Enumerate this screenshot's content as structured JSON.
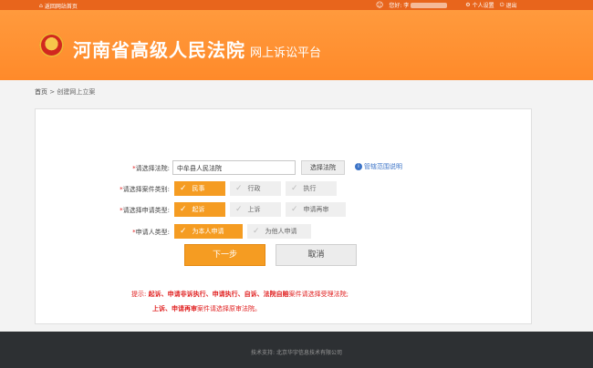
{
  "topbar": {
    "home_link": "返回网站首页",
    "greeting": "您好: 李",
    "personal_settings": "个人设置",
    "logout": "退出"
  },
  "banner": {
    "court_name": "河南省高级人民法院",
    "platform_name": "网上诉讼平台"
  },
  "breadcrumb": {
    "home": "首页",
    "separator": ">",
    "current": "创建网上立案"
  },
  "form": {
    "court": {
      "label": "请选择法院:",
      "value": "中牟县人民法院",
      "select_button": "选择法院",
      "jurisdiction_link": "管辖范围说明"
    },
    "case_type": {
      "label": "请选择案件类别:",
      "options": [
        {
          "label": "民事",
          "selected": true
        },
        {
          "label": "行政",
          "selected": false
        },
        {
          "label": "执行",
          "selected": false
        }
      ]
    },
    "application_type": {
      "label": "请选择申请类型:",
      "options": [
        {
          "label": "起诉",
          "selected": true
        },
        {
          "label": "上诉",
          "selected": false
        },
        {
          "label": "申请再审",
          "selected": false
        }
      ]
    },
    "applicant_type": {
      "label": "申请人类型:",
      "options": [
        {
          "label": "为本人申请",
          "selected": true
        },
        {
          "label": "为他人申请",
          "selected": false
        }
      ]
    },
    "next_button": "下一步",
    "cancel_button": "取消"
  },
  "hint": {
    "prefix": "提示:",
    "line1_bold": "起诉、申请非诉执行、申请执行、自诉、法院自赔",
    "line1_rest": "案件请选择受理法院;",
    "line2_bold": "上诉、申请再审",
    "line2_rest": "案件请选择原审法院。"
  },
  "footer": {
    "text": "技术支持: 北京华宇信息技术有限公司"
  },
  "colors": {
    "topbar": "#e8651c",
    "banner": "#ff8a2a",
    "accent": "#f59c22",
    "hint_red": "#e02020",
    "footer": "#2d3033"
  }
}
